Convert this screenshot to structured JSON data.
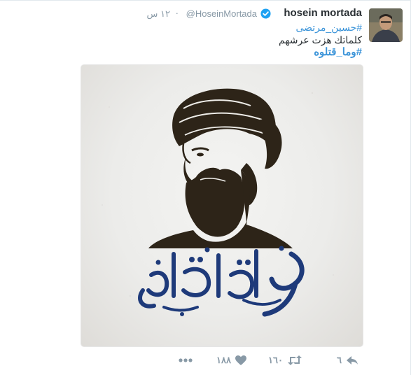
{
  "tweet": {
    "fullname": "hosein mortada",
    "handle": "@HoseinMortada",
    "time": "۱۲ س",
    "dot": "·",
    "text_lines": [
      "#حسين_مرتضى",
      "كلماتك هزت عرشهم",
      "#وما_قتلوه"
    ]
  },
  "media": {
    "calligraphy": "وما قتلوه"
  },
  "actions": {
    "reply_count": "٦",
    "retweet_count": "۱٦٠",
    "like_count": "۱۸۸"
  },
  "colors": {
    "link": "#3b94d9",
    "muted": "#8899a6",
    "verified": "#1da1f2",
    "calligraphy": "#1e3a7a",
    "portrait": "#2d2418"
  }
}
